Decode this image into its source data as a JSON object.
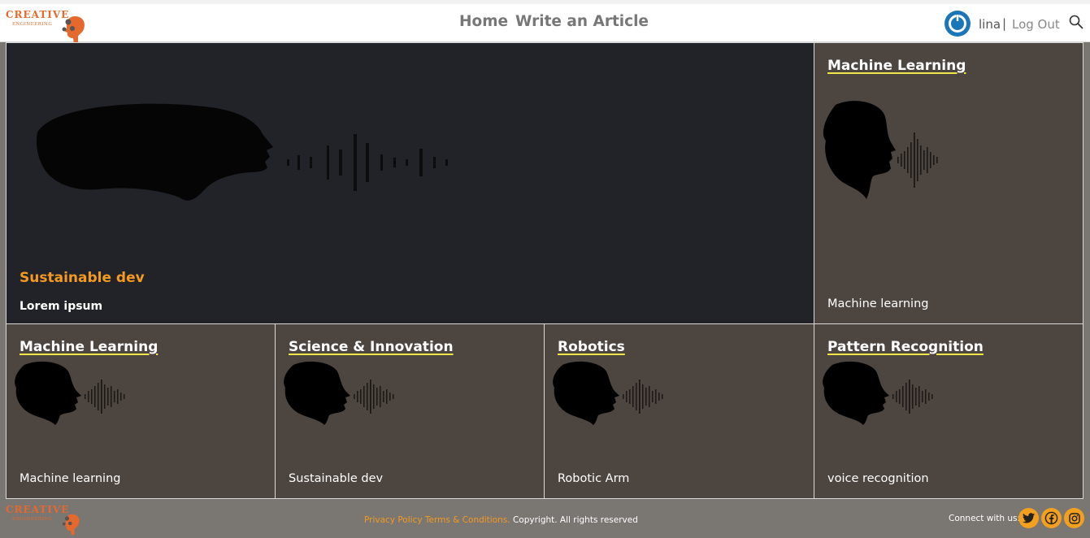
{
  "brand": {
    "line1": "CREATIVE",
    "line2": "ENGINEERING"
  },
  "nav": {
    "home": "Home",
    "write": "Write an Article"
  },
  "user": {
    "name": "lina",
    "separator": "|",
    "logout": "Log Out"
  },
  "hero": {
    "title": "Sustainable dev",
    "subtitle": "Lorem ipsum"
  },
  "cards": [
    {
      "title": "Machine Learning",
      "desc": "Machine learning"
    },
    {
      "title": "Machine Learning",
      "desc": "Machine learning"
    },
    {
      "title": "Science & Innovation",
      "desc": "Sustainable dev"
    },
    {
      "title": "Robotics",
      "desc": "Robotic Arm"
    },
    {
      "title": "Pattern Recognition",
      "desc": "voice recognition"
    }
  ],
  "footer": {
    "privacy": "Privacy Policy",
    "terms": "Terms & Conditions.",
    "copyright": " Copyright. All rights reserved",
    "connect": "Connect with us:"
  },
  "colors": {
    "accent": "#f39a21",
    "underline": "#f0e64a",
    "tile_bg": "#4d4540",
    "hero_bg": "#212328",
    "footer_bg": "#7a7672",
    "avatar": "#1a76b8"
  },
  "icons": [
    "logo-icon",
    "avatar-icon",
    "search-icon",
    "twitter-icon",
    "facebook-icon",
    "instagram-icon"
  ]
}
